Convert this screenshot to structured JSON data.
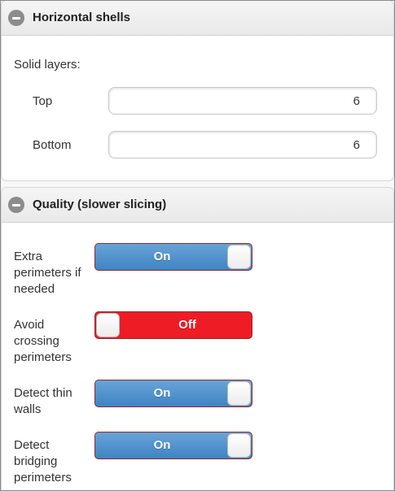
{
  "horizontal_shells": {
    "title": "Horizontal shells",
    "solid_layers_label": "Solid layers:",
    "top_label": "Top",
    "top_value": "6",
    "bottom_label": "Bottom",
    "bottom_value": "6"
  },
  "quality": {
    "title": "Quality (slower slicing)",
    "toggles": [
      {
        "label": "Extra perimeters if needed",
        "state": "On"
      },
      {
        "label": "Avoid crossing perimeters",
        "state": "Off"
      },
      {
        "label": "Detect thin walls",
        "state": "On"
      },
      {
        "label": "Detect bridging perimeters",
        "state": "On"
      }
    ]
  },
  "colors": {
    "toggle_on": "#4a8fcd",
    "toggle_off": "#ee1c25"
  },
  "icons": {
    "collapse": "minus-circle-icon"
  }
}
